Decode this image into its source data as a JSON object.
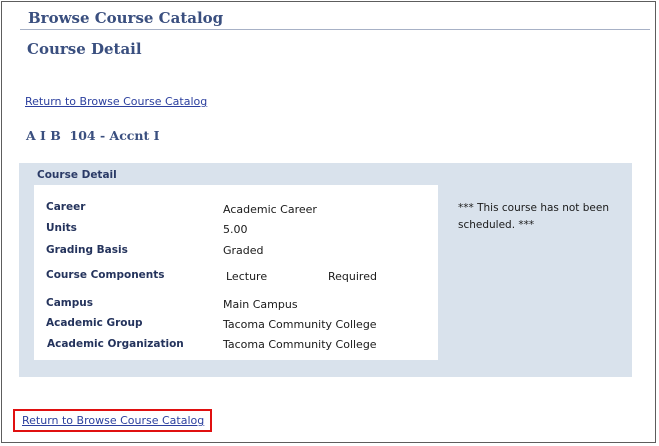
{
  "header": {
    "title": "Browse Course Catalog"
  },
  "page": {
    "title": "Course Detail"
  },
  "links": {
    "return_top": "Return to Browse Course Catalog",
    "return_bottom": "Return to Browse Course Catalog"
  },
  "course": {
    "heading": "A I B  104 - Accnt I"
  },
  "detail": {
    "section_label": "Course Detail",
    "fields": {
      "career": {
        "label": "Career",
        "value": "Academic Career"
      },
      "units": {
        "label": "Units",
        "value": "5.00"
      },
      "grading": {
        "label": "Grading Basis",
        "value": "Graded"
      },
      "components": {
        "label": "Course Components",
        "value": "Lecture",
        "status": "Required"
      },
      "campus": {
        "label": "Campus",
        "value": "Main Campus"
      },
      "group": {
        "label": "Academic Group",
        "value": "Tacoma Community College"
      },
      "org": {
        "label": "Academic Organization",
        "value": "Tacoma Community College"
      }
    },
    "schedule_note": "***  This course has not been scheduled.  ***"
  },
  "colors": {
    "accent": "#3a4f7f",
    "panel": "#d9e2ec",
    "highlight": "#e01010",
    "link": "#2b3f9e"
  }
}
